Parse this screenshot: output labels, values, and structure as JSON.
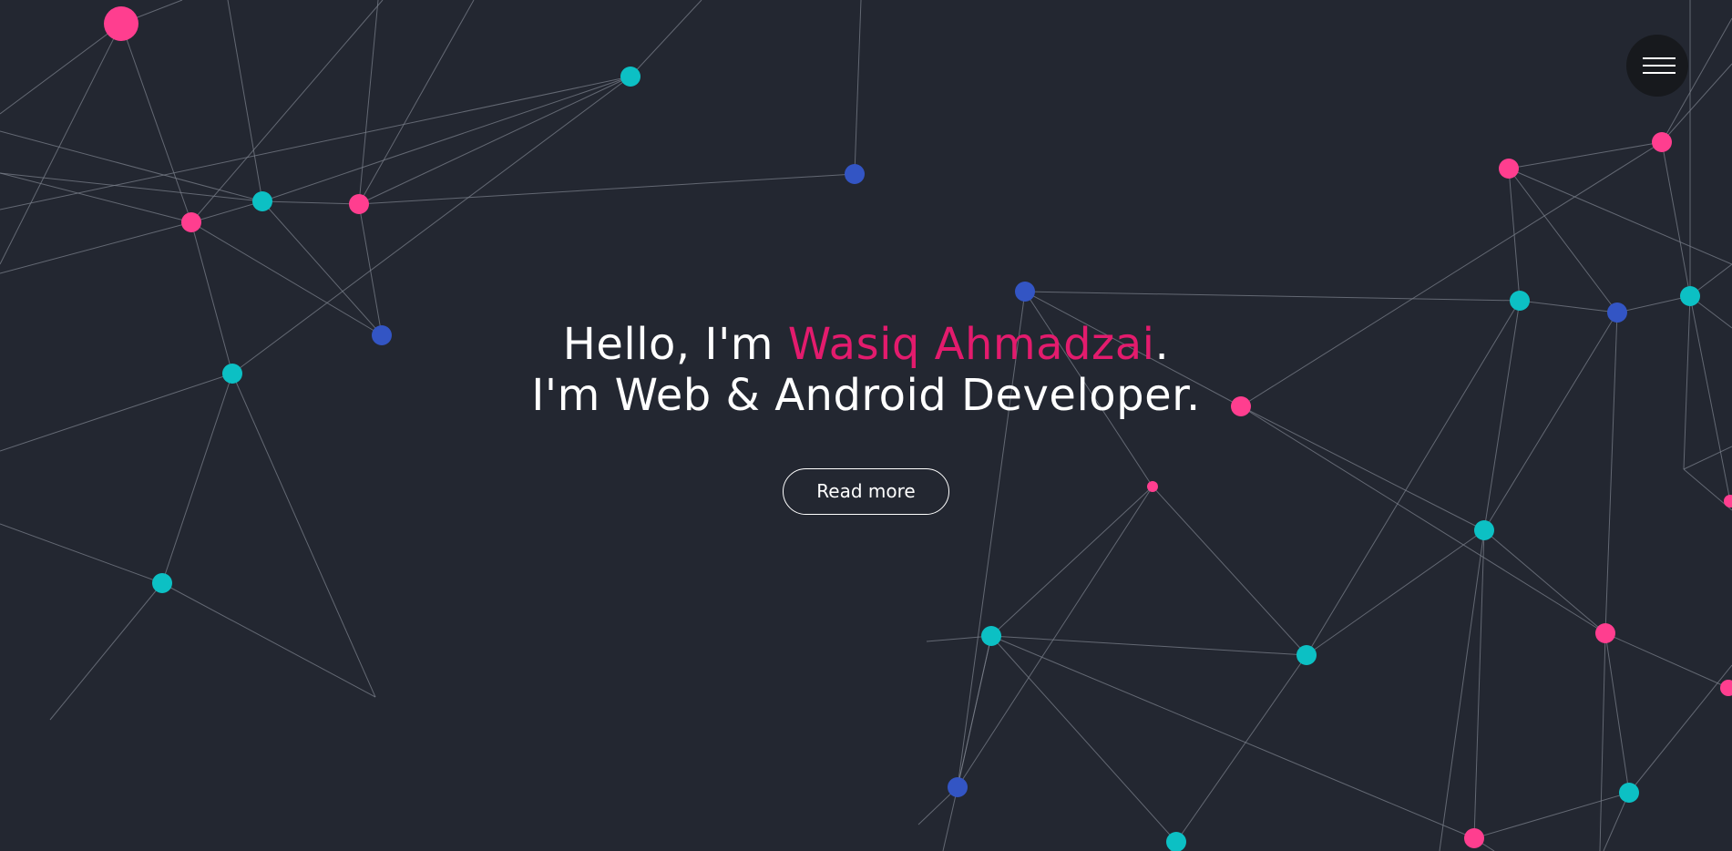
{
  "hero": {
    "greeting_prefix": "Hello, I'm ",
    "name": "Wasiq Ahmadzai",
    "greeting_suffix": ".",
    "tagline": "I'm Web & Android Developer.",
    "cta_label": "Read more"
  },
  "menu": {
    "icon": "hamburger-menu-icon"
  },
  "theme": {
    "background": "#232731",
    "accent": "#e31b6d",
    "node_pink": "#ff3e8f",
    "node_cyan": "#0cc0c4",
    "node_blue": "#3355c4",
    "link_color": "#7a7f8a"
  }
}
